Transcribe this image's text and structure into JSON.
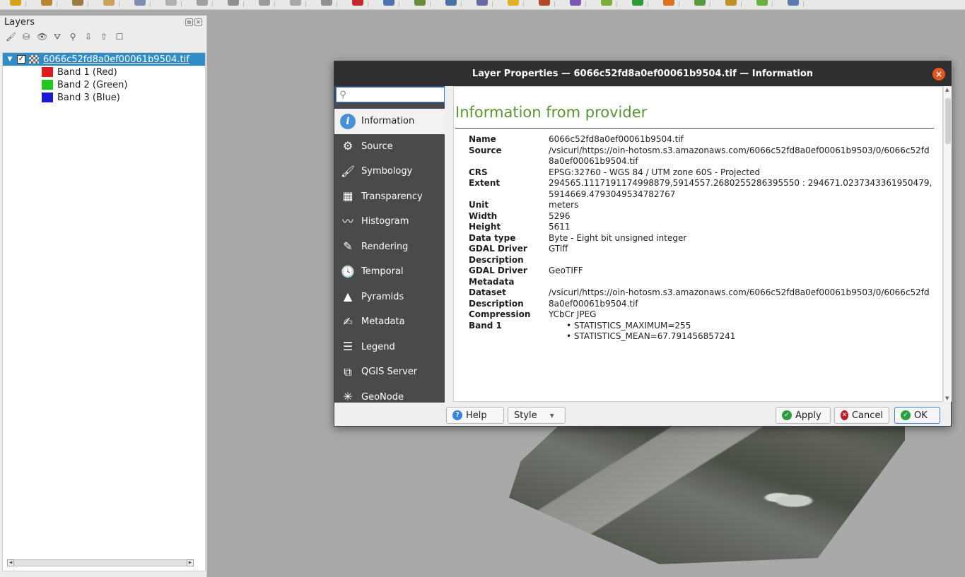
{
  "toolbar": {
    "icon_colors": [
      "#d9a21a",
      "#b8862e",
      "#9a7a40",
      "#c9a45a",
      "#7d8fb0",
      "#b0b0b0",
      "#a0a0a0",
      "#8f8f8f",
      "#9b9b9b",
      "#a8a8a8",
      "#909090",
      "#c8262c",
      "#5070b0",
      "#6a8a40",
      "#4a6fa5",
      "#6a6aa0",
      "#e0b020",
      "#b04a2a",
      "#7a5ab0",
      "#7ab03a",
      "#2a9a3a",
      "#e07020",
      "#5a9a3a",
      "#c09020",
      "#6ab040",
      "#5a7ab0"
    ]
  },
  "layers_panel": {
    "title": "Layers",
    "float_icon": "⧉",
    "close_icon": "✕",
    "tools": [
      "🖌",
      "⛁",
      "👁",
      "⛛",
      "⚲",
      "⇩",
      "⇧",
      "☐"
    ],
    "layer": {
      "name": "6066c52fd8a0ef00061b9504.tif",
      "expander": "▼",
      "checked": "✓"
    },
    "bands": [
      {
        "label": "Band 1 (Red)",
        "color": "#e31a1c"
      },
      {
        "label": "Band 2 (Green)",
        "color": "#1ec81e"
      },
      {
        "label": "Band 3 (Blue)",
        "color": "#1a1ad2"
      }
    ]
  },
  "dialog": {
    "title": "Layer Properties — 6066c52fd8a0ef00061b9504.tif — Information",
    "close_glyph": "×",
    "search": {
      "value": "",
      "placeholder": ""
    },
    "nav": [
      {
        "label": "Information",
        "icon": "information-icon",
        "glyph": "i"
      },
      {
        "label": "Source",
        "icon": "source-icon",
        "glyph": "⚙"
      },
      {
        "label": "Symbology",
        "icon": "symbology-icon",
        "glyph": "🖌"
      },
      {
        "label": "Transparency",
        "icon": "transparency-icon",
        "glyph": "▦"
      },
      {
        "label": "Histogram",
        "icon": "histogram-icon",
        "glyph": "〰"
      },
      {
        "label": "Rendering",
        "icon": "rendering-icon",
        "glyph": "✎"
      },
      {
        "label": "Temporal",
        "icon": "temporal-icon",
        "glyph": "🕓"
      },
      {
        "label": "Pyramids",
        "icon": "pyramids-icon",
        "glyph": "▲"
      },
      {
        "label": "Metadata",
        "icon": "metadata-icon",
        "glyph": "✍"
      },
      {
        "label": "Legend",
        "icon": "legend-icon",
        "glyph": "☰"
      },
      {
        "label": "QGIS Server",
        "icon": "qgis-server-icon",
        "glyph": "⧉"
      },
      {
        "label": "GeoNode",
        "icon": "geonode-icon",
        "glyph": "✳"
      }
    ],
    "content": {
      "heading": "Information from provider",
      "rows": [
        {
          "key": "Name",
          "value": "6066c52fd8a0ef00061b9504.tif"
        },
        {
          "key": "Source",
          "value": "/vsicurl/https://oin-hotosm.s3.amazonaws.com/6066c52fd8a0ef00061b9503/0/6066c52fd8a0ef00061b9504.tif"
        },
        {
          "key": "CRS",
          "value": "EPSG:32760 - WGS 84 / UTM zone 60S - Projected"
        },
        {
          "key": "Extent",
          "value": "294565.1117191174998879,5914557.2680255286395550 : 294671.0237343361950479,5914669.4793049534782767"
        },
        {
          "key": "Unit",
          "value": "meters"
        },
        {
          "key": "Width",
          "value": "5296"
        },
        {
          "key": "Height",
          "value": "5611"
        },
        {
          "key": "Data type",
          "value": "Byte - Eight bit unsigned integer"
        },
        {
          "key": "GDAL Driver Description",
          "value": "GTiff"
        },
        {
          "key": "GDAL Driver Metadata",
          "value": "GeoTIFF"
        },
        {
          "key": "Dataset Description",
          "value": "/vsicurl/https://oin-hotosm.s3.amazonaws.com/6066c52fd8a0ef00061b9503/0/6066c52fd8a0ef00061b9504.tif"
        },
        {
          "key": "Compression",
          "value": "YCbCr JPEG"
        }
      ],
      "band1": {
        "key": "Band 1",
        "items": [
          "STATISTICS_MAXIMUM=255",
          "STATISTICS_MEAN=67.791456857241"
        ]
      }
    },
    "buttons": {
      "help": "Help",
      "style": "Style",
      "apply": "Apply",
      "cancel": "Cancel",
      "ok": "OK"
    },
    "colors": {
      "accent": "#589632",
      "titlebar": "#2f2f2f",
      "close": "#e95420",
      "sidebar": "#4a4a4a"
    }
  }
}
